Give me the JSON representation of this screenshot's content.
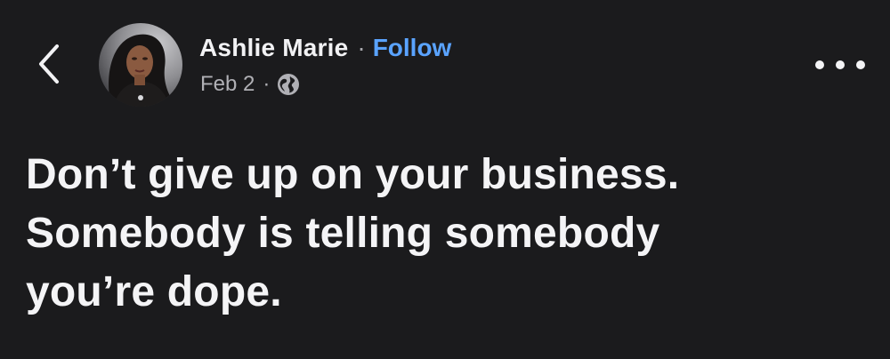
{
  "post": {
    "author": "Ashlie Marie",
    "separator": "·",
    "follow_label": "Follow",
    "date": "Feb 2",
    "meta_separator": "·",
    "visibility_icon": "globe-icon",
    "lines": [
      "Don’t give up on your business.",
      "Somebody is telling somebody",
      "you’re dope."
    ]
  },
  "icons": {
    "back": "chevron-left-icon",
    "more": "more-horizontal-icon"
  },
  "colors": {
    "background": "#1b1b1d",
    "text_primary": "#f4f4f6",
    "text_secondary": "#b0b0b5",
    "accent": "#5aa3ff"
  }
}
